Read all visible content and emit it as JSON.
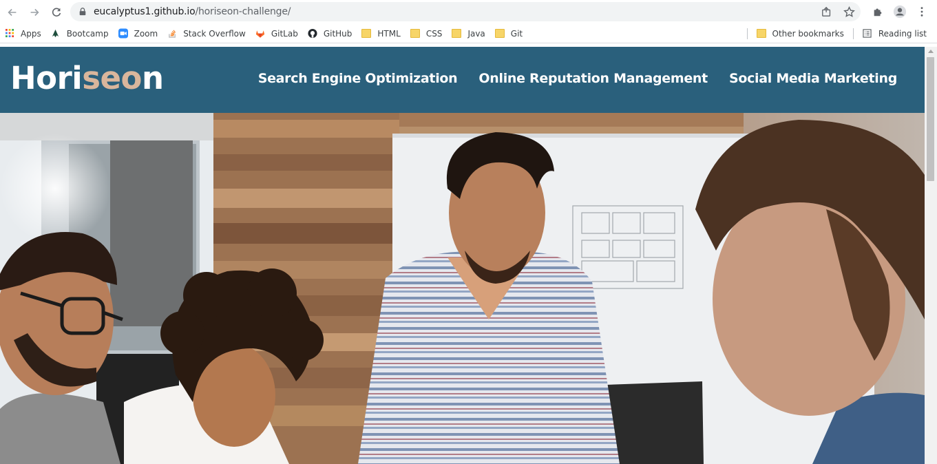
{
  "browser": {
    "url_host": "eucalyptus1.github.io",
    "url_path": "/horiseon-challenge/"
  },
  "bookmarks": {
    "items": [
      {
        "label": "Apps",
        "icon": "apps-grid-icon"
      },
      {
        "label": "Bootcamp",
        "icon": "bootcamp-icon"
      },
      {
        "label": "Zoom",
        "icon": "zoom-icon"
      },
      {
        "label": "Stack Overflow",
        "icon": "stack-overflow-icon"
      },
      {
        "label": "GitLab",
        "icon": "gitlab-icon"
      },
      {
        "label": "GitHub",
        "icon": "github-icon"
      },
      {
        "label": "HTML",
        "icon": "folder-icon"
      },
      {
        "label": "CSS",
        "icon": "folder-icon"
      },
      {
        "label": "Java",
        "icon": "folder-icon"
      },
      {
        "label": "Git",
        "icon": "folder-icon"
      }
    ],
    "other_bookmarks": "Other bookmarks",
    "reading_list": "Reading list"
  },
  "site": {
    "logo_main": "Hori",
    "logo_accent": "seo",
    "logo_end": "n",
    "nav": [
      {
        "label": "Search Engine Optimization"
      },
      {
        "label": "Online Reputation Management"
      },
      {
        "label": "Social Media Marketing"
      }
    ],
    "colors": {
      "header_bg": "#2a607c",
      "logo_accent": "#d9b69c"
    }
  }
}
